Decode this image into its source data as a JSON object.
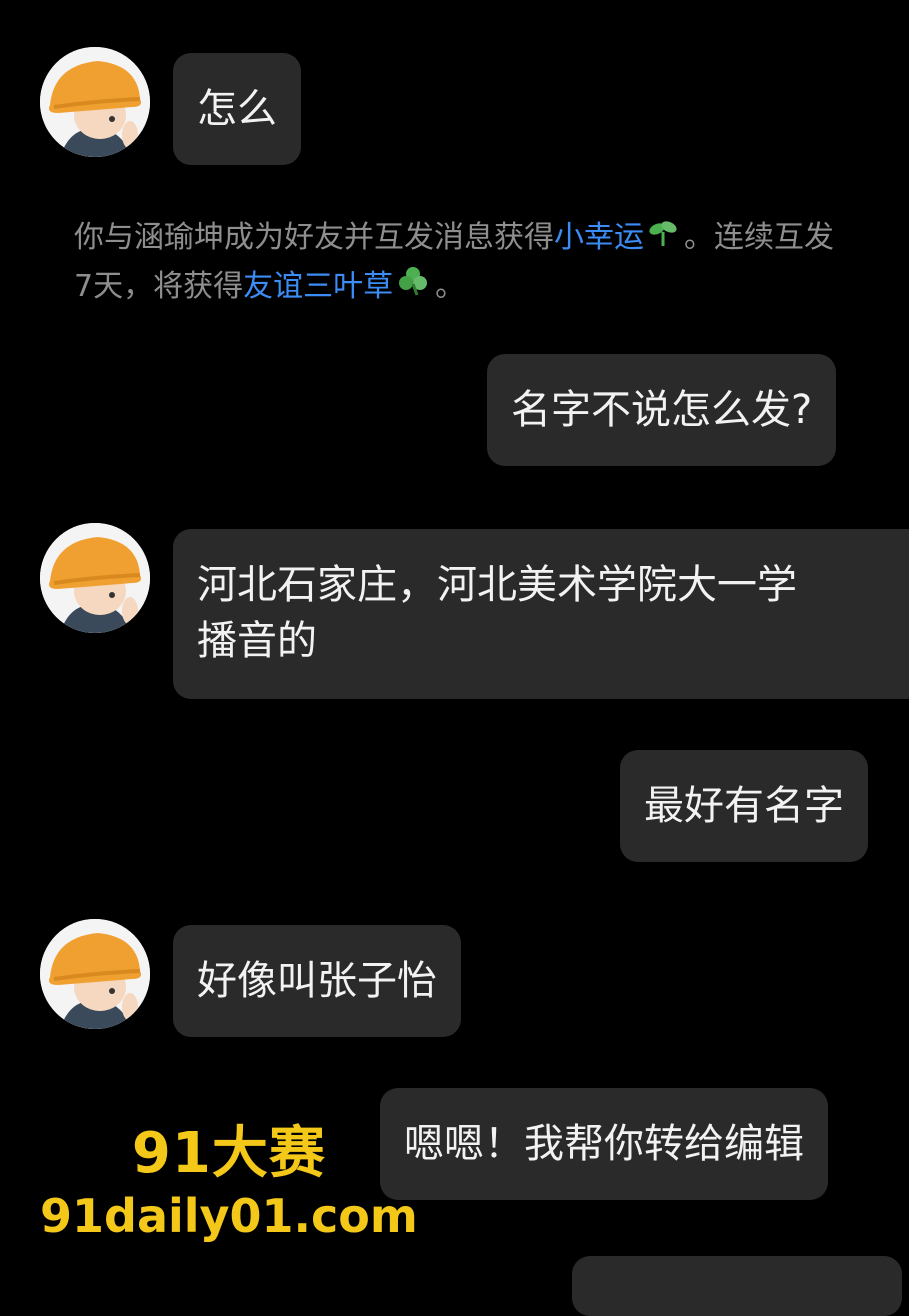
{
  "messages": [
    {
      "side": "left",
      "text": "怎么"
    },
    {
      "side": "right",
      "text": "名字不说怎么发?"
    },
    {
      "side": "left",
      "lines": [
        "河北石家庄，河北美术学院大一学",
        "播音的"
      ]
    },
    {
      "side": "right",
      "text": "最好有名字"
    },
    {
      "side": "left",
      "text": "好像叫张子怡"
    },
    {
      "side": "right",
      "text": "嗯嗯！我帮你转给编辑"
    }
  ],
  "notice": {
    "line1_prefix": "你与涵瑜坤成为好友并互发消息获得",
    "line1_link": "小幸运",
    "line1_icon": "sprout-icon",
    "line1_suffix": "。连续互发",
    "line2_prefix": "7天，将获得",
    "line2_link": "友谊三叶草",
    "line2_icon": "clover-icon",
    "line2_suffix": "。"
  },
  "watermark": {
    "title": "91大赛",
    "url": "91daily01.com"
  },
  "colors": {
    "background": "#000000",
    "bubble": "#2a2a2a",
    "link": "#3b8cf5",
    "notice_text": "#8e8e8e",
    "watermark": "#f3c818"
  }
}
